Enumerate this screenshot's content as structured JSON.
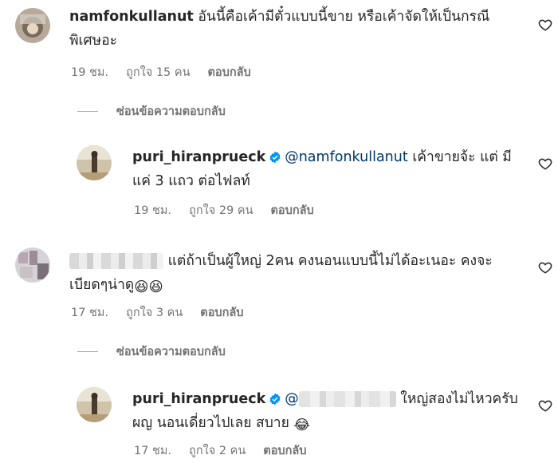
{
  "comments": [
    {
      "username": "namfonkullanut",
      "text_line1": "อันนี้คือเค้ามีตั๋วแบบนี้ขาย หรือเค้าจัดให้เป็นกรณี",
      "text_line2": "พิเศษอะ",
      "time": "19 ชม.",
      "likes": "ถูกใจ 15 คน",
      "reply": "ตอบกลับ",
      "hide_replies": "ซ่อนข้อความตอบกลับ",
      "replies": [
        {
          "username": "puri_hiranprueck",
          "mention": "@namfonkullanut",
          "text_line1": "เค้าขายจ้ะ แต่ มี",
          "text_line2": "แค่ 3 แถว ต่อไฟลท์",
          "time": "19 ชม.",
          "likes": "ถูกใจ 29 คน",
          "reply": "ตอบกลับ"
        }
      ]
    },
    {
      "username": "",
      "text_line1": "แต่ถ้าเป็นผู้ใหญ่ 2คน คงนอนแบบนี้ไม่ได้อะเนอะ คงจะ",
      "text_line2": "เบียดๆน่าดู",
      "emoji": "😆😆",
      "time": "17 ชม.",
      "likes": "ถูกใจ 3 คน",
      "reply": "ตอบกลับ",
      "hide_replies": "ซ่อนข้อความตอบกลับ",
      "replies": [
        {
          "username": "puri_hiranprueck",
          "mention": "@",
          "text_line1": "ใหญ่สองไม่ไหวครับ",
          "text_line2": "ผญ นอนเดี่ยวไปเลย สบาย",
          "emoji": "😂",
          "time": "17 ชม.",
          "likes": "ถูกใจ 2 คน",
          "reply": "ตอบกลับ"
        }
      ]
    }
  ],
  "colors": {
    "verified": "#0095f6",
    "mention": "#00376b",
    "meta": "#737373"
  },
  "icons": {
    "like": "heart-outline-icon",
    "verified": "verified-badge-icon"
  }
}
